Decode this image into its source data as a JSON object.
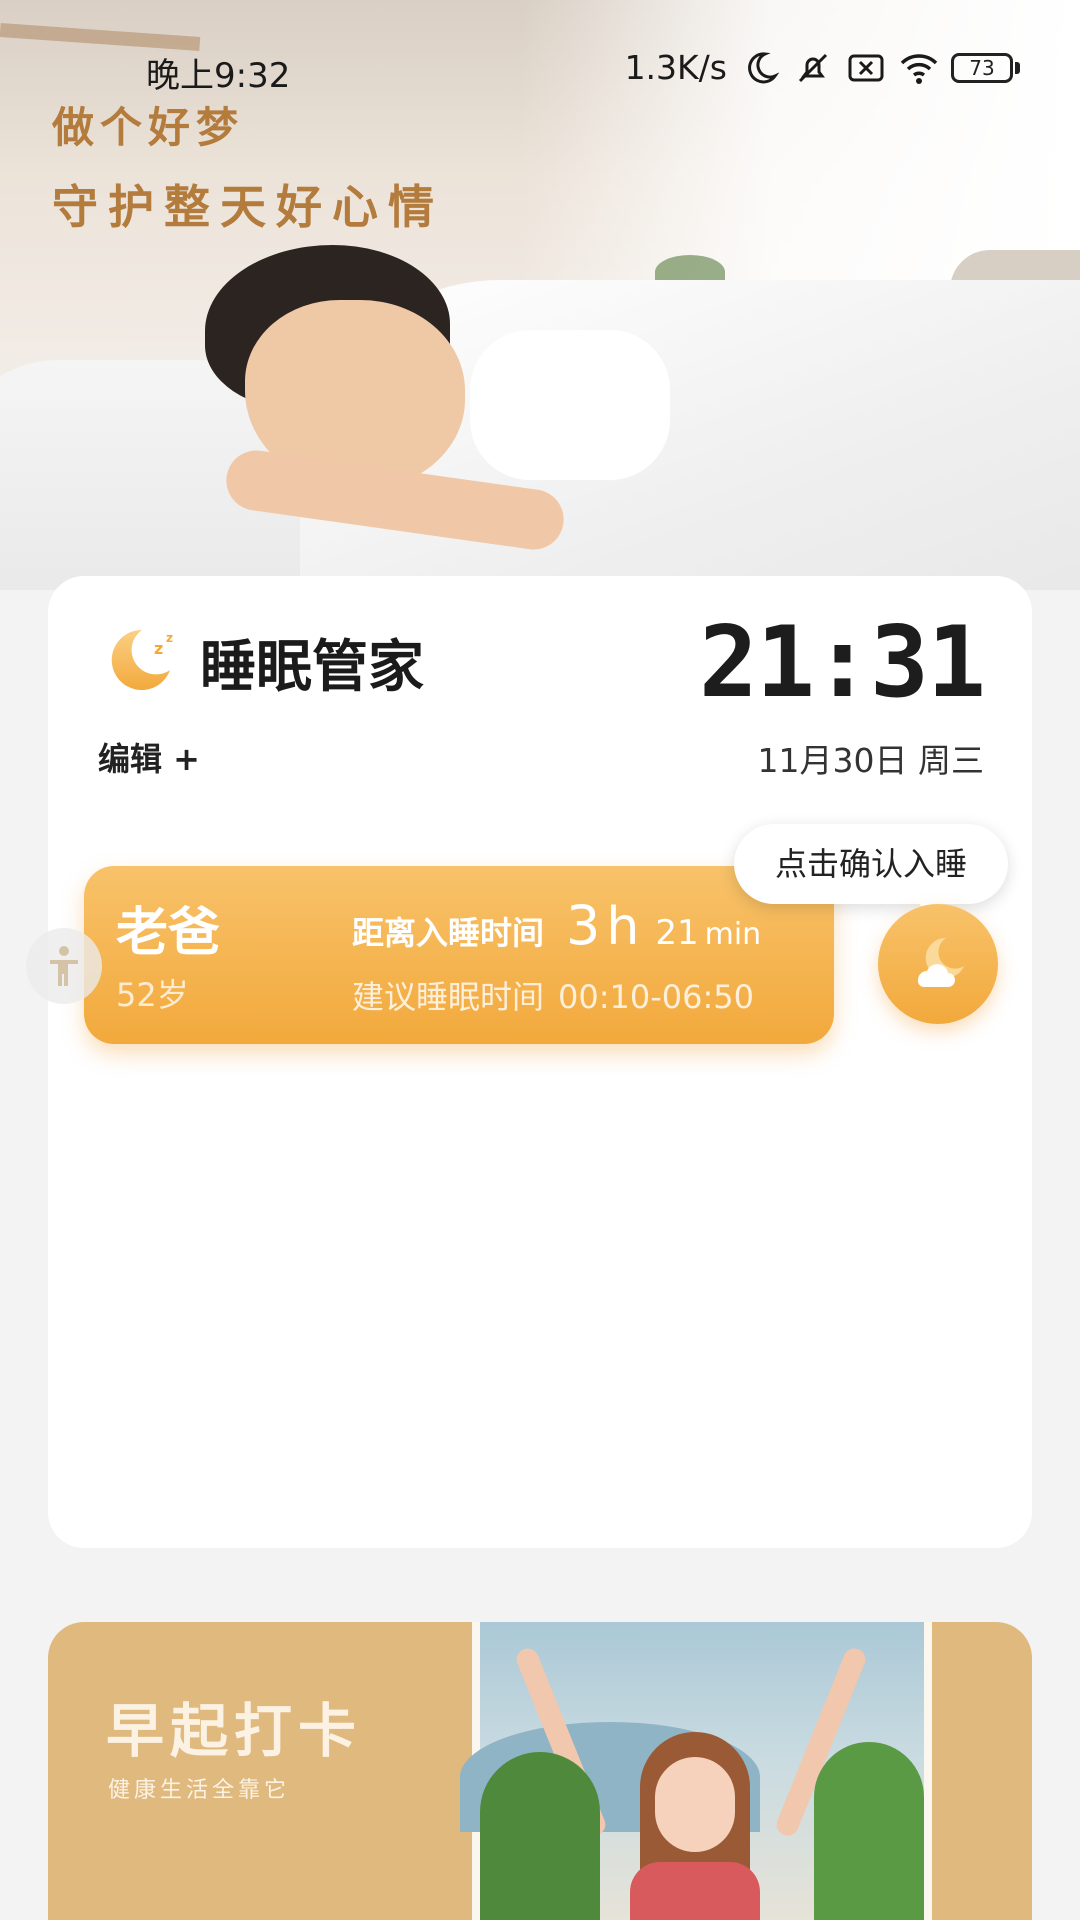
{
  "status_bar": {
    "time": "晚上9:32",
    "network_speed": "1.3K/s",
    "battery": "73",
    "icons": [
      "moon-icon",
      "mute-bell-icon",
      "sim-blocked-icon",
      "wifi-icon",
      "battery-icon"
    ]
  },
  "hero": {
    "line1": "做个好梦",
    "line2": "守护整天好心情"
  },
  "sleep_card": {
    "title": "睡眠管家",
    "clock_hours": "21",
    "clock_sep": ":",
    "clock_minutes": "31",
    "edit_label": "编辑 +",
    "date": "11月30日 周三",
    "tooltip": "点击确认入睡",
    "member": {
      "name": "老爸",
      "age": "52岁",
      "countdown_label": "距离入睡时间",
      "countdown_hours": "3",
      "countdown_hours_unit": "h",
      "countdown_minutes": "21",
      "countdown_minutes_unit": "min",
      "suggest_label": "建议睡眠时间",
      "suggest_range": "00:10-06:50"
    }
  },
  "early_card": {
    "title": "早起打卡",
    "subtitle": "健康生活全靠它"
  },
  "colors": {
    "accent": "#f2a93c",
    "hero_text": "#b37b3c",
    "early_bg": "#e0b97f"
  }
}
